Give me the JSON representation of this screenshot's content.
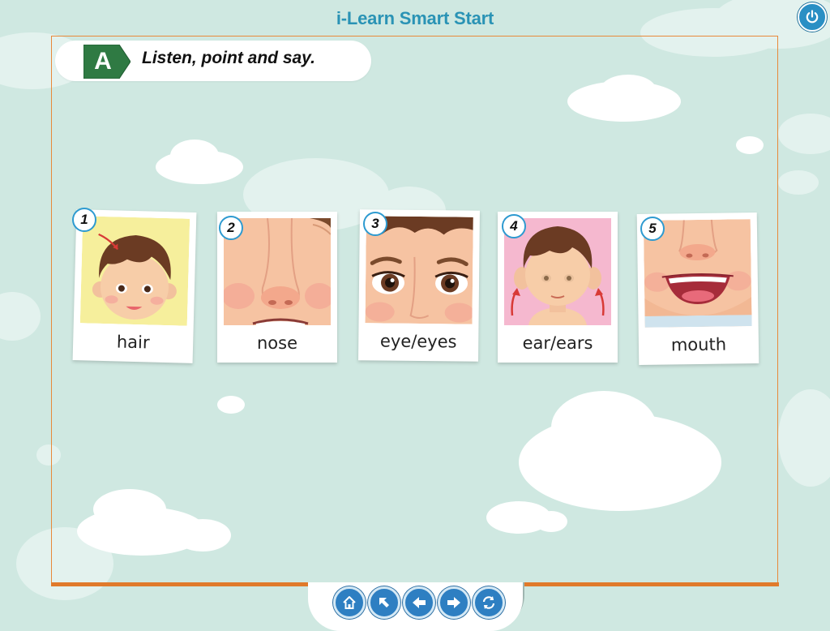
{
  "app": {
    "title": "i-Learn Smart Start"
  },
  "activity": {
    "badge_letter": "A",
    "instruction": "Listen, point and say."
  },
  "cards": [
    {
      "number": "1",
      "label": "hair"
    },
    {
      "number": "2",
      "label": "nose"
    },
    {
      "number": "3",
      "label": "eye/eyes"
    },
    {
      "number": "4",
      "label": "ear/ears"
    },
    {
      "number": "5",
      "label": "mouth"
    }
  ],
  "navigation": [
    {
      "icon": "home-icon"
    },
    {
      "icon": "arrow-up-left-icon"
    },
    {
      "icon": "arrow-left-icon"
    },
    {
      "icon": "arrow-right-icon"
    },
    {
      "icon": "refresh-icon"
    }
  ],
  "colors": {
    "background": "#cfe8e1",
    "title": "#2a93b5",
    "frame_border": "#e8893a",
    "badge": "#2f7a43",
    "button": "#2e7fc2"
  }
}
